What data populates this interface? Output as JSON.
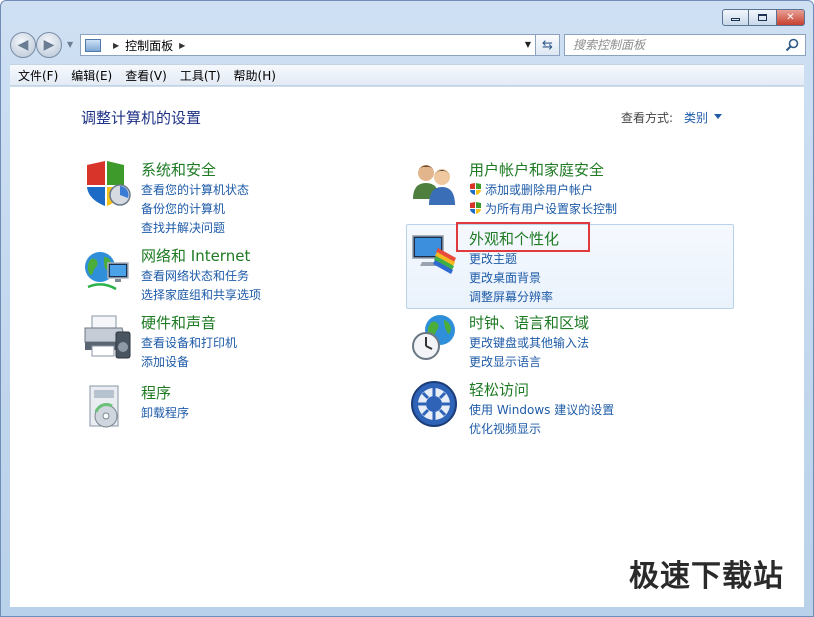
{
  "window": {
    "caption_min": "",
    "caption_max": "",
    "caption_close": "✕"
  },
  "nav": {
    "back_glyph": "◀",
    "fwd_glyph": "▶",
    "address_crumb": "控制面板",
    "refresh_glyph": "⇆",
    "search_placeholder": "搜索控制面板"
  },
  "menu": [
    "文件(F)",
    "编辑(E)",
    "查看(V)",
    "工具(T)",
    "帮助(H)"
  ],
  "header": {
    "title": "调整计算机的设置",
    "view_label": "查看方式:",
    "view_value": "类别"
  },
  "categories": {
    "security": {
      "title": "系统和安全",
      "links": [
        "查看您的计算机状态",
        "备份您的计算机",
        "查找并解决问题"
      ]
    },
    "network": {
      "title": "网络和 Internet",
      "links": [
        "查看网络状态和任务",
        "选择家庭组和共享选项"
      ]
    },
    "hardware": {
      "title": "硬件和声音",
      "links": [
        "查看设备和打印机",
        "添加设备"
      ]
    },
    "programs": {
      "title": "程序",
      "links": [
        "卸载程序"
      ]
    },
    "users": {
      "title": "用户帐户和家庭安全",
      "links": [
        "添加或删除用户帐户",
        "为所有用户设置家长控制"
      ]
    },
    "appearance": {
      "title": "外观和个性化",
      "links": [
        "更改主题",
        "更改桌面背景",
        "调整屏幕分辨率"
      ]
    },
    "clock": {
      "title": "时钟、语言和区域",
      "links": [
        "更改键盘或其他输入法",
        "更改显示语言"
      ]
    },
    "ease": {
      "title": "轻松访问",
      "links": [
        "使用 Windows 建议的设置",
        "优化视频显示"
      ]
    }
  },
  "watermark": "极速下载站",
  "colors": {
    "category_title": "#1e7a23",
    "link": "#1e5ba8",
    "highlight": "#e0393e"
  }
}
